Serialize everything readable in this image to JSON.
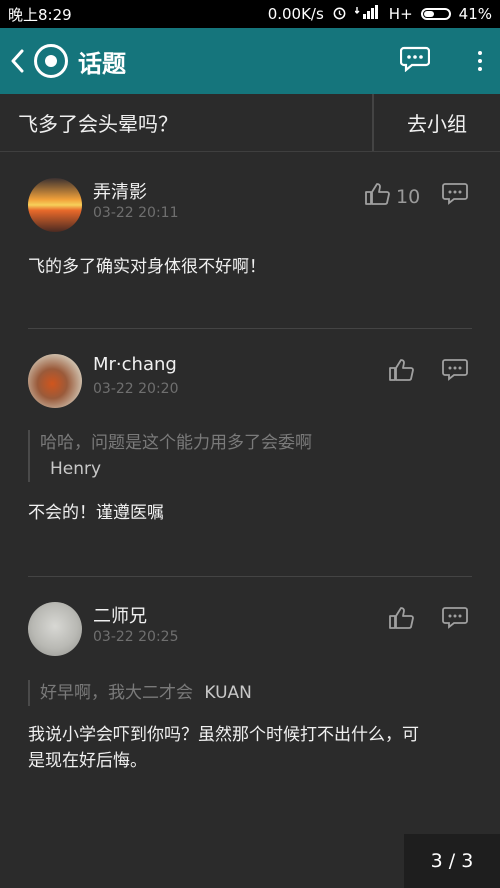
{
  "status_bar": {
    "time": "晚上8:29",
    "network_speed": "0.00K/s",
    "network_type": "H+",
    "battery": "41%",
    "battery_level": 0.41
  },
  "app_bar": {
    "title": "话题",
    "icons": [
      "back-arrow-icon",
      "app-logo-icon",
      "comment-icon",
      "more-vertical-icon"
    ],
    "color": "#15757c"
  },
  "topic": {
    "title": "飞多了会头晕吗？",
    "group_button": "去小组"
  },
  "posts": [
    {
      "username": "弄清影",
      "time": "03-22 20:11",
      "likes": "10",
      "text": "飞的多了确实对身体很不好啊！"
    },
    {
      "username": "Mr·chang",
      "time": "03-22 20:20",
      "quote": {
        "text": "哈哈，问题是这个能力用多了会委啊",
        "author": "Henry"
      },
      "text": "不会的！谨遵医嘱"
    },
    {
      "username": "二师兄",
      "time": "03-22 20:25",
      "quote": {
        "text": "好早啊，我大二才会",
        "author": "KUAN"
      },
      "text": "我说小学会吓到你吗？虽然那个时候打不出什么，可是现在好后悔。"
    }
  ],
  "pagination": "3 / 3"
}
